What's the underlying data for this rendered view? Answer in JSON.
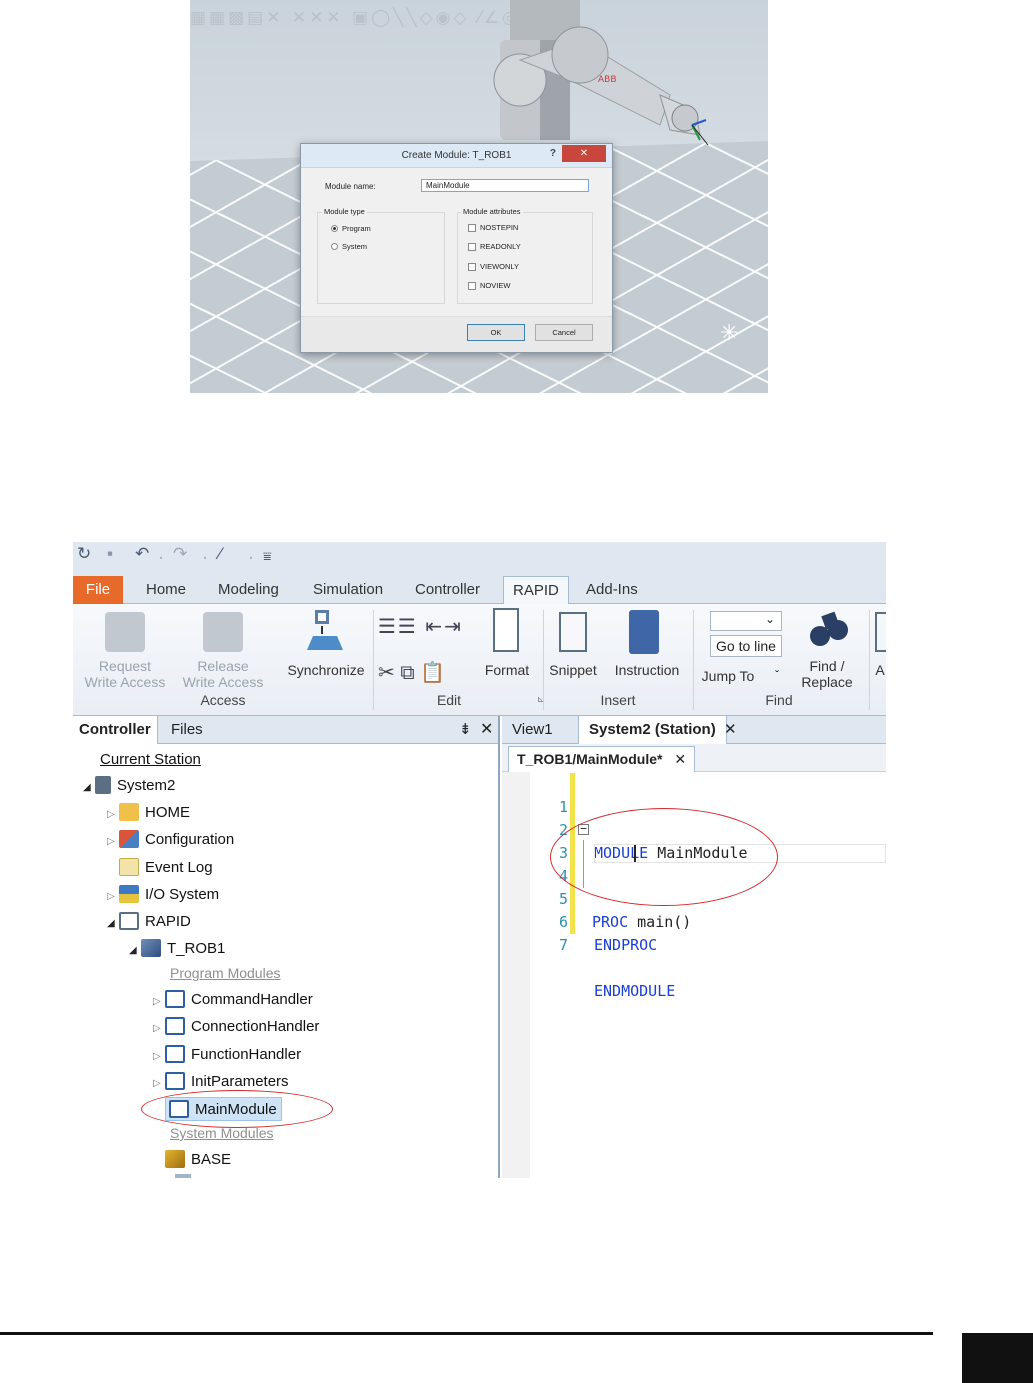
{
  "dialog": {
    "title": "Create Module: T_ROB1",
    "help": "?",
    "close": "✕",
    "module_name_label": "Module name:",
    "module_name_value": "MainModule",
    "module_type_label": "Module type",
    "type_options": [
      "Program",
      "System"
    ],
    "selected_type": "Program",
    "attributes_label": "Module attributes",
    "attributes": [
      "NOSTEPIN",
      "READONLY",
      "VIEWONLY",
      "NOVIEW"
    ],
    "ok": "OK",
    "cancel": "Cancel"
  },
  "ribbon": {
    "tabs": [
      "File",
      "Home",
      "Modeling",
      "Simulation",
      "Controller",
      "RAPID",
      "Add-Ins"
    ],
    "active_tab": "RAPID",
    "request_write": [
      "Request",
      "Write Access"
    ],
    "release_write": [
      "Release",
      "Write Access"
    ],
    "synchronize": "Synchronize",
    "format": "Format",
    "snippet": "Snippet",
    "instruction": "Instruction",
    "go_to_line": "Go to line",
    "jump_to": "Jump To",
    "find_replace": [
      "Find /",
      "Replace"
    ],
    "partial": "A",
    "groups": [
      "Access",
      "Edit",
      "Insert",
      "Find"
    ]
  },
  "left_pane": {
    "tabs": [
      "Controller",
      "Files"
    ],
    "current_station": "Current Station",
    "tree": {
      "system": "System2",
      "home": "HOME",
      "configuration": "Configuration",
      "event_log": "Event Log",
      "io_system": "I/O System",
      "rapid": "RAPID",
      "task": "T_ROB1",
      "program_modules_label": "Program Modules",
      "program_modules": [
        "CommandHandler",
        "ConnectionHandler",
        "FunctionHandler",
        "InitParameters",
        "MainModule"
      ],
      "system_modules_label": "System Modules",
      "system_modules": [
        "BASE"
      ]
    }
  },
  "right_pane": {
    "doc_tabs": [
      "View1",
      "System2 (Station)"
    ],
    "file_tab": "T_ROB1/MainModule*",
    "code": [
      {
        "n": "1",
        "kw": "MODULE",
        "rest": " MainModule"
      },
      {
        "n": "2",
        "kw": "",
        "rest": ""
      },
      {
        "n": "3",
        "kw": "PROC",
        "rest": " main()"
      },
      {
        "n": "4",
        "kw": "",
        "rest": ""
      },
      {
        "n": "5",
        "kw": "ENDPROC",
        "rest": ""
      },
      {
        "n": "6",
        "kw": "",
        "rest": ""
      },
      {
        "n": "7",
        "kw": "ENDMODULE",
        "rest": ""
      }
    ]
  },
  "colors": {
    "file_tab": "#e86a2b",
    "keyword": "#1a3fd6",
    "annotation": "#d42a2a",
    "line_numbers": "#2b91af"
  },
  "icons": [
    "undo-icon",
    "redo-icon",
    "save-icon",
    "close-icon",
    "folder-icon",
    "configuration-icon",
    "event-log-icon",
    "io-system-icon",
    "module-icon",
    "task-icon",
    "binoculars-icon"
  ]
}
